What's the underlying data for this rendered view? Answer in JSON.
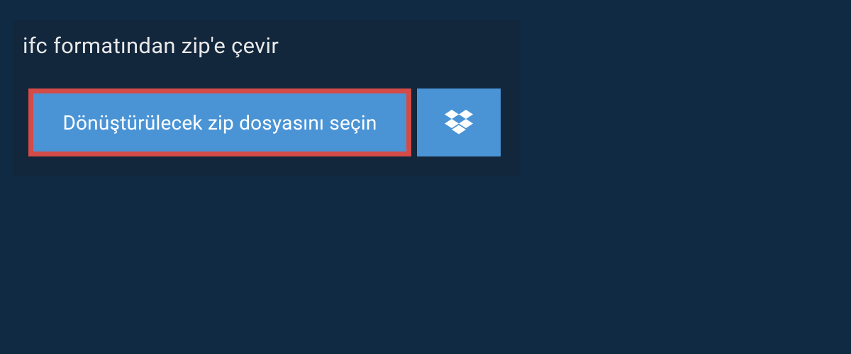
{
  "panel": {
    "title": "ifc formatından zip'e çevir",
    "file_select_label": "Dönüştürülecek zip dosyasını seçin"
  },
  "colors": {
    "page_bg": "#0f2a42",
    "panel_bg": "#12263c",
    "button_bg": "#4a94d6",
    "button_border": "#d44b47",
    "text_light": "#ffffff"
  }
}
